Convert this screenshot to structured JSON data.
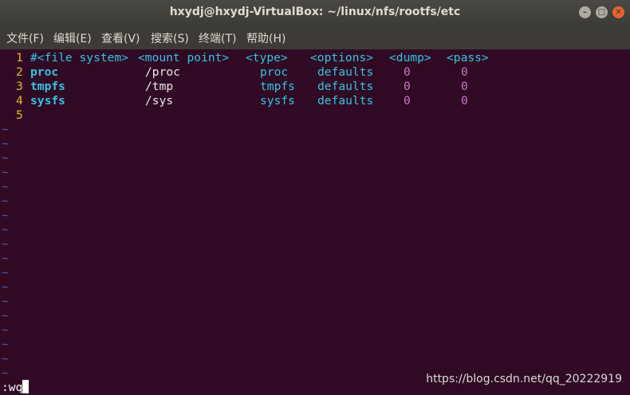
{
  "window": {
    "title": "hxydj@hxydj-VirtualBox: ~/linux/nfs/rootfs/etc"
  },
  "controls": {
    "minimize": "–",
    "maximize": "□",
    "close": "✕"
  },
  "menu": [
    "文件(F)",
    "编辑(E)",
    "查看(V)",
    "搜索(S)",
    "终端(T)",
    "帮助(H)"
  ],
  "editor": {
    "lines": [
      {
        "num": "1",
        "cols": [
          "#<file system>",
          "<mount point>",
          "<type>",
          "<options>",
          "<dump>",
          "<pass>"
        ]
      },
      {
        "num": "2",
        "cols": [
          "proc",
          "/proc",
          "proc",
          "defaults",
          "0",
          "0"
        ]
      },
      {
        "num": "3",
        "cols": [
          "tmpfs",
          "/tmp",
          "tmpfs",
          "defaults",
          "0",
          "0"
        ]
      },
      {
        "num": "4",
        "cols": [
          "sysfs",
          "/sys",
          "sysfs",
          "defaults",
          "0",
          "0"
        ]
      },
      {
        "num": "5",
        "cols": []
      }
    ],
    "tilde": "~",
    "command": ":wq"
  },
  "watermark": "https://blog.csdn.net/qq_20222919",
  "colors": {
    "background": "#300a24",
    "line_number": "#e5b923",
    "keyword": "#34c4e0",
    "number": "#c678c4",
    "tilde": "#4f5aa8"
  }
}
